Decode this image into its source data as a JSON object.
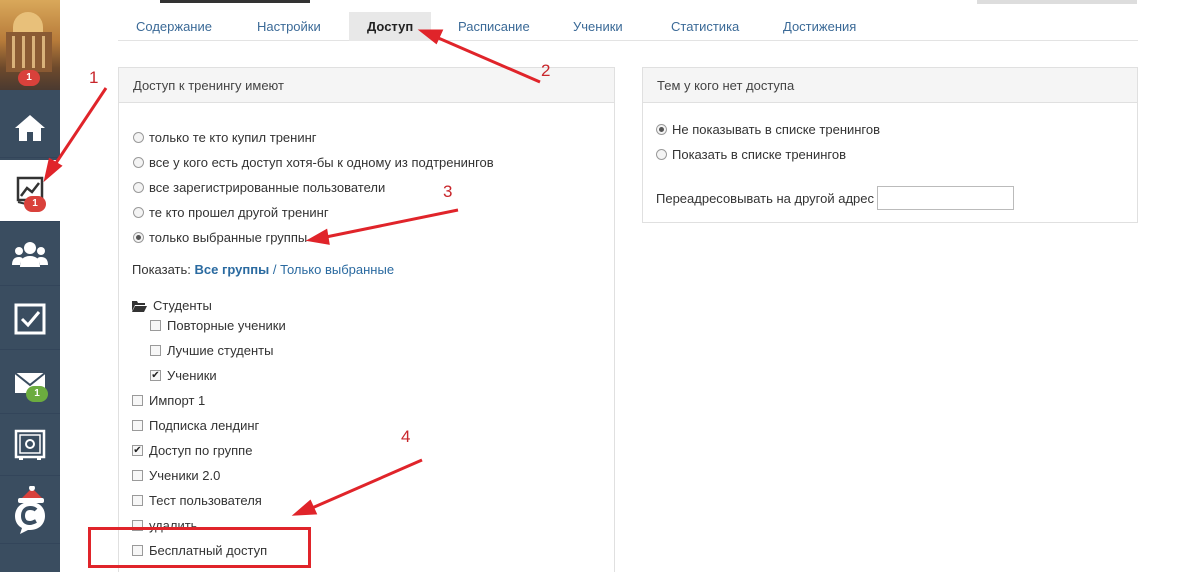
{
  "sidebar": {
    "avatar_badge": "1",
    "items": [
      {
        "name": "home",
        "icon": "home-icon",
        "badge": ""
      },
      {
        "name": "trainings",
        "icon": "chart-icon",
        "badge": "1",
        "active": true
      },
      {
        "name": "users",
        "icon": "users-icon",
        "badge": ""
      },
      {
        "name": "tasks",
        "icon": "checkbox-icon",
        "badge": ""
      },
      {
        "name": "messages",
        "icon": "mail-icon",
        "badge": "1"
      },
      {
        "name": "settings",
        "icon": "safe-icon",
        "badge": ""
      },
      {
        "name": "chat",
        "icon": "chat-logo-icon",
        "badge": ""
      }
    ]
  },
  "tabs": [
    {
      "label": "Содержание"
    },
    {
      "label": "Настройки"
    },
    {
      "label": "Доступ",
      "active": true
    },
    {
      "label": "Расписание"
    },
    {
      "label": "Ученики"
    },
    {
      "label": "Статистика"
    },
    {
      "label": "Достижения"
    }
  ],
  "access_panel": {
    "title": "Доступ к тренингу имеют",
    "options": [
      {
        "label": "только те кто купил тренинг",
        "selected": false
      },
      {
        "label": "все у кого есть доступ хотя-бы к одному из подтренингов",
        "selected": false
      },
      {
        "label": "все зарегистрированные пользователи",
        "selected": false
      },
      {
        "label": "те кто прошел другой тренинг",
        "selected": false
      },
      {
        "label": "только выбранные группы",
        "selected": true
      }
    ],
    "show_label": "Показать:",
    "show_all": "Все группы",
    "show_separator": "/",
    "show_selected": "Только выбранные",
    "folder": {
      "label": "Студенты",
      "children": [
        {
          "label": "Повторные ученики",
          "checked": false
        },
        {
          "label": "Лучшие студенты",
          "checked": false
        },
        {
          "label": "Ученики",
          "checked": true
        }
      ]
    },
    "groups": [
      {
        "label": "Импорт 1",
        "checked": false
      },
      {
        "label": "Подписка лендинг",
        "checked": false
      },
      {
        "label": "Доступ по группе",
        "checked": true
      },
      {
        "label": "Ученики 2.0",
        "checked": false
      },
      {
        "label": "Тест пользователя",
        "checked": false
      },
      {
        "label": "удалить",
        "checked": false
      },
      {
        "label": "Бесплатный доступ",
        "checked": false
      }
    ]
  },
  "no_access_panel": {
    "title": "Тем у кого нет доступа",
    "options": [
      {
        "label": "Не показывать в списке тренингов",
        "selected": true
      },
      {
        "label": "Показать в списке тренингов",
        "selected": false
      }
    ],
    "redirect_label": "Переадресовывать на другой адрес",
    "redirect_value": ""
  },
  "annotations": {
    "n1": "1",
    "n2": "2",
    "n3": "3",
    "n4": "4",
    "color": "#e0242a"
  }
}
